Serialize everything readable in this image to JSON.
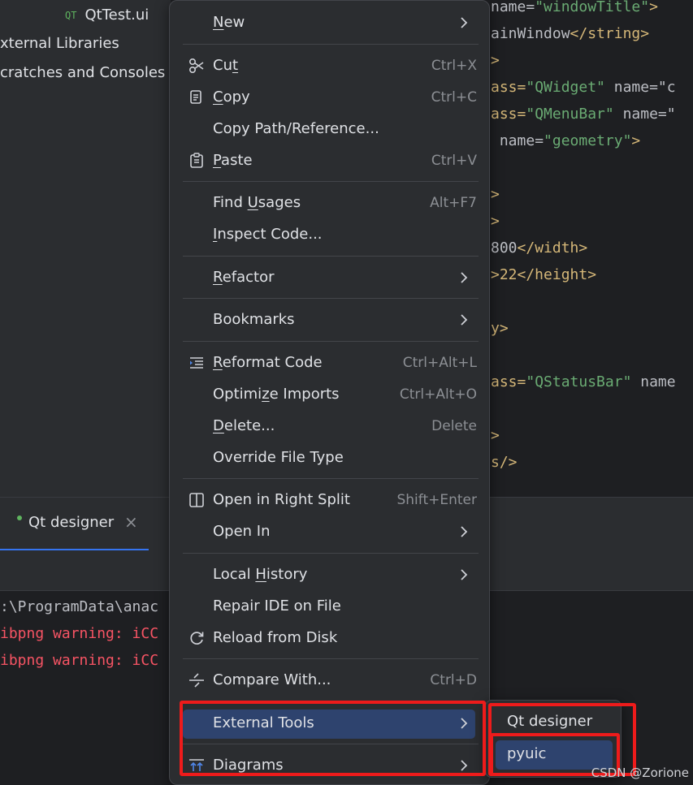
{
  "project": {
    "file_tab": "QtTest.ui",
    "file_icon": "QT",
    "tree": [
      "xternal Libraries",
      "cratches and Consoles"
    ]
  },
  "editor": {
    "lines": [
      {
        "pre": "",
        "a": "name=",
        "s": "\"windowTitle\"",
        "t": ">"
      },
      {
        "pre": "",
        "a": "",
        "s": "ainWindow",
        "t": "</string>"
      },
      {
        "pre": "",
        "a": "",
        "s": "",
        "t": ">"
      },
      {
        "pre": "",
        "a": "ass=",
        "s": "\"QWidget\"",
        "t": " name=\"c"
      },
      {
        "pre": "",
        "a": "ass=",
        "s": "\"QMenuBar\"",
        "t": " name=\""
      },
      {
        "pre": " ",
        "a": "name=",
        "s": "\"geometry\"",
        "t": ">"
      },
      {
        "pre": "",
        "a": "",
        "s": "",
        "t": ""
      },
      {
        "pre": "",
        "a": "",
        "s": "",
        "t": ">"
      },
      {
        "pre": "",
        "a": "",
        "s": "",
        "t": ">"
      },
      {
        "pre": "",
        "a": "800",
        "s": "",
        "t": "</width>"
      },
      {
        "pre": "",
        "a": "",
        "s": "",
        "t": ">22</height>"
      },
      {
        "pre": "",
        "a": "",
        "s": "",
        "t": ""
      },
      {
        "pre": "",
        "a": "",
        "s": "",
        "t": "y>"
      },
      {
        "pre": "",
        "a": "",
        "s": "",
        "t": ""
      },
      {
        "pre": "",
        "a": "ass=",
        "s": "\"QStatusBar\"",
        "t": " name"
      },
      {
        "pre": "",
        "a": "",
        "s": "",
        "t": ""
      },
      {
        "pre": "",
        "a": "",
        "s": "",
        "t": ">"
      },
      {
        "pre": "",
        "a": "",
        "s": "",
        "t": "s/>"
      }
    ]
  },
  "run": {
    "tab_label": "Qt designer",
    "tab_close": "×",
    "console": [
      ":\\ProgramData\\anac",
      "ibpng warning: iCC",
      "ibpng warning: iCC"
    ]
  },
  "menu": {
    "items": [
      {
        "id": "new",
        "pre": "",
        "ul": "N",
        "post": "ew",
        "shortcut": "",
        "submenu": true,
        "icon": ""
      },
      {
        "id": "cut",
        "pre": "Cu",
        "ul": "t",
        "post": "",
        "shortcut": "Ctrl+X",
        "submenu": false,
        "icon": "scissors-icon"
      },
      {
        "id": "copy",
        "pre": "",
        "ul": "C",
        "post": "opy",
        "shortcut": "Ctrl+C",
        "submenu": false,
        "icon": "copy-icon"
      },
      {
        "id": "copy-path",
        "pre": "Copy Path/Reference...",
        "ul": "",
        "post": "",
        "shortcut": "",
        "submenu": false,
        "icon": ""
      },
      {
        "id": "paste",
        "pre": "",
        "ul": "P",
        "post": "aste",
        "shortcut": "Ctrl+V",
        "submenu": false,
        "icon": "paste-icon"
      },
      {
        "id": "find-usages",
        "pre": "Find ",
        "ul": "U",
        "post": "sages",
        "shortcut": "Alt+F7",
        "submenu": false,
        "icon": ""
      },
      {
        "id": "inspect-code",
        "pre": "",
        "ul": "I",
        "post": "nspect Code...",
        "shortcut": "",
        "submenu": false,
        "icon": ""
      },
      {
        "id": "refactor",
        "pre": "",
        "ul": "R",
        "post": "efactor",
        "shortcut": "",
        "submenu": true,
        "icon": ""
      },
      {
        "id": "bookmarks",
        "pre": "Bookmarks",
        "ul": "",
        "post": "",
        "shortcut": "",
        "submenu": true,
        "icon": ""
      },
      {
        "id": "reformat-code",
        "pre": "",
        "ul": "R",
        "post": "eformat Code",
        "shortcut": "Ctrl+Alt+L",
        "submenu": false,
        "icon": "reformat-icon"
      },
      {
        "id": "optimize-imports",
        "pre": "Optimi",
        "ul": "z",
        "post": "e Imports",
        "shortcut": "Ctrl+Alt+O",
        "submenu": false,
        "icon": ""
      },
      {
        "id": "delete",
        "pre": "",
        "ul": "D",
        "post": "elete...",
        "shortcut": "Delete",
        "submenu": false,
        "icon": ""
      },
      {
        "id": "override-file-type",
        "pre": "Override File Type",
        "ul": "",
        "post": "",
        "shortcut": "",
        "submenu": false,
        "icon": ""
      },
      {
        "id": "open-right-split",
        "pre": "Open in Right Split",
        "ul": "",
        "post": "",
        "shortcut": "Shift+Enter",
        "submenu": false,
        "icon": "split-icon"
      },
      {
        "id": "open-in",
        "pre": "Open In",
        "ul": "",
        "post": "",
        "shortcut": "",
        "submenu": true,
        "icon": ""
      },
      {
        "id": "local-history",
        "pre": "Local ",
        "ul": "H",
        "post": "istory",
        "shortcut": "",
        "submenu": true,
        "icon": ""
      },
      {
        "id": "repair-ide",
        "pre": "Repair IDE on File",
        "ul": "",
        "post": "",
        "shortcut": "",
        "submenu": false,
        "icon": ""
      },
      {
        "id": "reload-disk",
        "pre": "Reload from Disk",
        "ul": "",
        "post": "",
        "shortcut": "",
        "submenu": false,
        "icon": "reload-icon"
      },
      {
        "id": "compare-with",
        "pre": "Compare With...",
        "ul": "",
        "post": "",
        "shortcut": "Ctrl+D",
        "submenu": false,
        "icon": "compare-icon"
      },
      {
        "id": "external-tools",
        "pre": "External Tools",
        "ul": "",
        "post": "",
        "shortcut": "",
        "submenu": true,
        "icon": ""
      },
      {
        "id": "diagrams",
        "pre": "Diagrams",
        "ul": "",
        "post": "",
        "shortcut": "",
        "submenu": true,
        "icon": "diagram-icon"
      }
    ]
  },
  "submenu": {
    "items": [
      "Qt designer",
      "pyuic"
    ]
  },
  "watermark": "CSDN @Zorione",
  "colors": {
    "selection": "#2e436e",
    "highlight": "#ee1b1b",
    "menu_bg": "#2b2d30"
  }
}
